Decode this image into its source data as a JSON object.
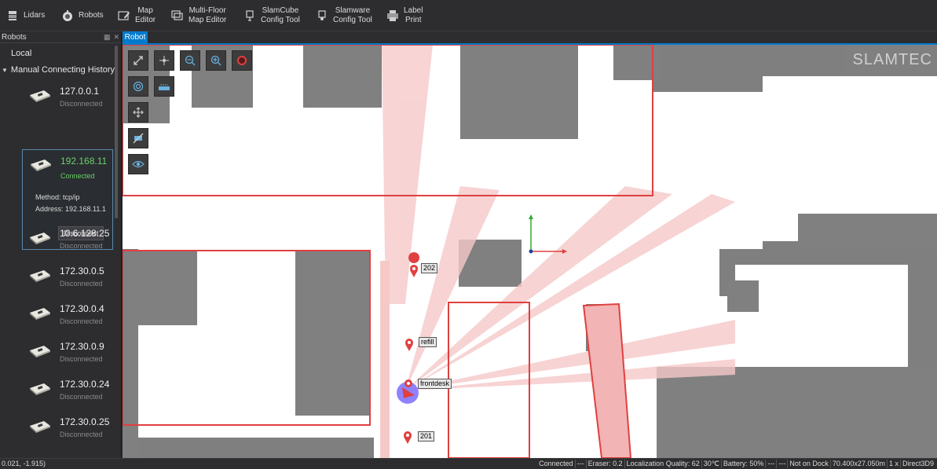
{
  "toolbar": {
    "lidars": "Lidars",
    "robots": "Robots",
    "map_editor_1": "Map",
    "map_editor_2": "Editor",
    "multi_floor_1": "Multi-Floor",
    "multi_floor_2": "Map Editor",
    "slamcube_1": "SlamCube",
    "slamcube_2": "Config Tool",
    "slamware_1": "Slamware",
    "slamware_2": "Config Tool",
    "label_1": "Label",
    "label_2": "Print"
  },
  "panel": {
    "title": "Robots",
    "local": "Local",
    "manual_history": "Manual Connecting History"
  },
  "robots": [
    {
      "ip": "127.0.0.1",
      "status": "Disconnected"
    },
    {
      "ip": "10.6.128.25",
      "status": "Disconnected"
    },
    {
      "ip": "172.30.0.5",
      "status": "Disconnected"
    },
    {
      "ip": "172.30.0.4",
      "status": "Disconnected"
    },
    {
      "ip": "172.30.0.9",
      "status": "Disconnected"
    },
    {
      "ip": "172.30.0.24",
      "status": "Disconnected"
    },
    {
      "ip": "172.30.0.25",
      "status": "Disconnected"
    }
  ],
  "selected": {
    "ip": "192.168.11",
    "status": "Connected",
    "method": "Method: tcp/ip",
    "address": "Address: 192.168.11.1",
    "disconnect": "Disconnect"
  },
  "tab": {
    "label": "Robot"
  },
  "map": {
    "brand": "SLAMTEC",
    "poi": {
      "p202": "202",
      "refill": "refill",
      "frontdesk": "frontdesk",
      "p201": "201"
    },
    "colors": {
      "accent": "#007acc",
      "connected": "#6ad06a",
      "zone": "#e04040",
      "robot": "#7b6cff"
    }
  },
  "status": {
    "coords": "0.021, -1.915)",
    "connected": "Connected",
    "dash1": "---",
    "eraser": "Eraser: 0.2",
    "quality": "Localization Quality: 62",
    "temp": "30℃",
    "battery": "Battery: 50%",
    "dash2": "---",
    "dash3": "---",
    "dock": "Not on Dock",
    "size": "70.400x27.050m",
    "zoom": "1 x",
    "renderer": "Direct3D9"
  }
}
